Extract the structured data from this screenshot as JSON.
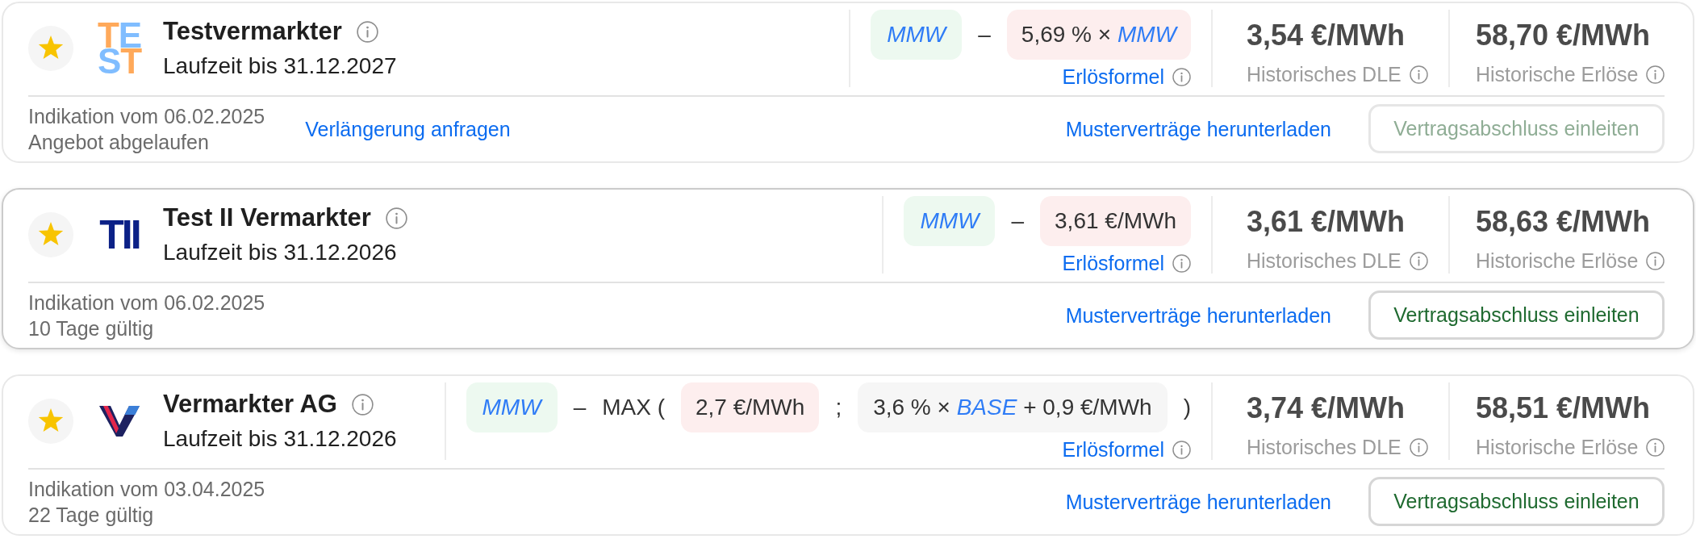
{
  "offers": [
    {
      "selected": false,
      "favorite": true,
      "logo": {
        "kind": "stacked",
        "lines": [
          [
            {
              "text": "T",
              "color": "#ffa95a"
            },
            {
              "text": "E",
              "color": "#80bdff"
            }
          ],
          [
            {
              "text": "S",
              "color": "#80bdff"
            },
            {
              "text": "T",
              "color": "#ffa95a"
            }
          ]
        ]
      },
      "name": "Testvermarkter",
      "term": "Laufzeit bis 31.12.2027",
      "formula": [
        {
          "kind": "base",
          "text": "MMW"
        },
        {
          "kind": "operator",
          "text": "–"
        },
        {
          "kind": "deduction",
          "text": "5,69 % × *MMW*"
        }
      ],
      "formula_link": "Erlösformel",
      "stats": [
        {
          "value": "3,54 €/MWh",
          "label": "Historisches DLE"
        },
        {
          "value": "58,70 €/MWh",
          "label": "Historische Erlöse"
        }
      ],
      "indication": "Indikation vom 06.02.2025",
      "validity": "Angebot abgelaufen",
      "extension_link": "Verlängerung anfragen",
      "download_link": "Musterverträge herunterladen",
      "contract_button": {
        "label": "Vertragsabschluss einleiten",
        "disabled": true
      }
    },
    {
      "selected": true,
      "favorite": true,
      "logo": {
        "kind": "wordmark",
        "text": "TII",
        "color": "#0c2187"
      },
      "name": "Test II Vermarkter",
      "term": "Laufzeit bis 31.12.2026",
      "formula": [
        {
          "kind": "base",
          "text": "MMW"
        },
        {
          "kind": "operator",
          "text": "–"
        },
        {
          "kind": "deduction",
          "text": "3,61 €/MWh"
        }
      ],
      "formula_link": "Erlösformel",
      "stats": [
        {
          "value": "3,61 €/MWh",
          "label": "Historisches DLE"
        },
        {
          "value": "58,63 €/MWh",
          "label": "Historische Erlöse"
        }
      ],
      "indication": "Indikation vom 06.02.2025",
      "validity": "10 Tage gültig",
      "download_link": "Musterverträge herunterladen",
      "contract_button": {
        "label": "Vertragsabschluss einleiten",
        "disabled": false
      }
    },
    {
      "selected": false,
      "favorite": true,
      "logo": {
        "kind": "v-mark"
      },
      "name": "Vermarkter AG",
      "term": "Laufzeit bis 31.12.2026",
      "formula": [
        {
          "kind": "base",
          "text": "MMW"
        },
        {
          "kind": "operator",
          "text": "–"
        },
        {
          "kind": "operator",
          "text": "MAX ("
        },
        {
          "kind": "deduction",
          "text": "2,7 €/MWh"
        },
        {
          "kind": "operator",
          "text": ";"
        },
        {
          "kind": "alternative",
          "text": "3,6 % × *BASE* + 0,9 €/MWh"
        },
        {
          "kind": "operator",
          "text": ")"
        }
      ],
      "formula_link": "Erlösformel",
      "stats": [
        {
          "value": "3,74 €/MWh",
          "label": "Historisches DLE"
        },
        {
          "value": "58,51 €/MWh",
          "label": "Historische Erlöse"
        }
      ],
      "indication": "Indikation vom 03.04.2025",
      "validity": "22 Tage gültig",
      "download_link": "Musterverträge herunterladen",
      "contract_button": {
        "label": "Vertragsabschluss einleiten",
        "disabled": false
      }
    }
  ]
}
